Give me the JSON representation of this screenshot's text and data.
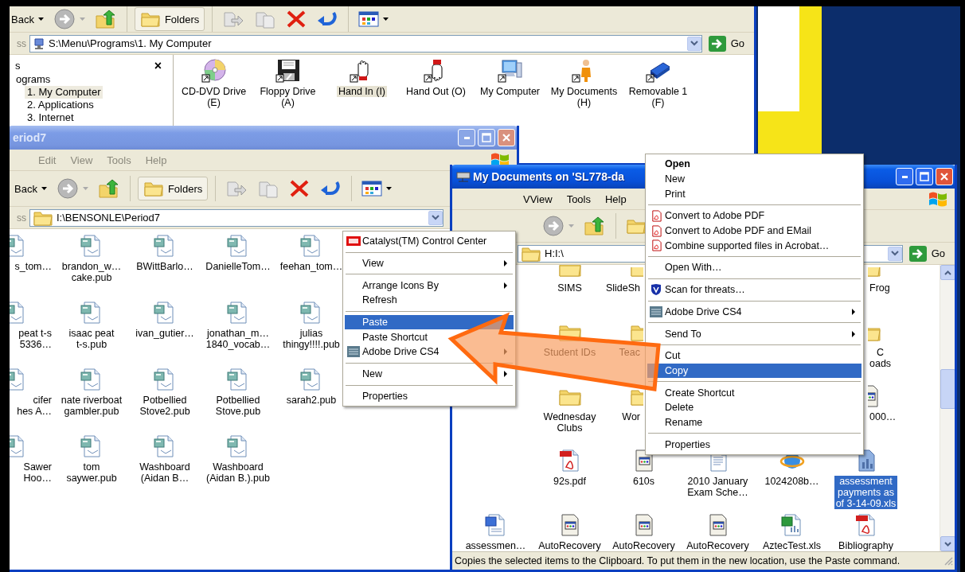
{
  "computer_window": {
    "toolbar": {
      "back": "Back",
      "folders": "Folders"
    },
    "address": {
      "label": "ss",
      "path": "S:\\Menu\\Programs\\1. My Computer",
      "go": "Go"
    },
    "pane": {
      "title": "s",
      "close": "×",
      "tree": [
        {
          "label": "ograms",
          "selected": false,
          "children": [
            {
              "label": "1. My Computer",
              "selected": true
            },
            {
              "label": "2. Applications",
              "selected": false
            },
            {
              "label": "3. Internet",
              "selected": false
            }
          ]
        }
      ]
    },
    "icons": [
      {
        "kind": "cd",
        "label": "CD-DVD Drive\n(E)",
        "selected": false
      },
      {
        "kind": "floppy",
        "label": "Floppy Drive\n(A)",
        "selected": false
      },
      {
        "kind": "hand_in",
        "label": "Hand In (I)",
        "selected": true
      },
      {
        "kind": "hand_out",
        "label": "Hand Out (O)",
        "selected": false
      },
      {
        "kind": "computer",
        "label": "My Computer",
        "selected": false
      },
      {
        "kind": "person",
        "label": "My Documents\n(H)",
        "selected": false
      },
      {
        "kind": "usb",
        "label": "Removable 1\n(F)",
        "selected": false
      }
    ]
  },
  "period_window": {
    "title": "eriod7",
    "active": false,
    "menu": [
      "Edit",
      "View",
      "Tools",
      "Help"
    ],
    "toolbar": {
      "back": "Back",
      "folders": "Folders"
    },
    "address": {
      "label": "ss",
      "path": "I:\\BENSONLE\\Period7"
    },
    "files": [
      [
        {
          "kind": "pub",
          "label": "s_tom…"
        },
        {
          "kind": "pub",
          "label": "brandon_w…\ncake.pub"
        },
        {
          "kind": "pub",
          "label": "BWittBarlo…"
        },
        {
          "kind": "pub",
          "label": "DanielleTom…"
        },
        {
          "kind": "pub",
          "label": "feehan_tom…"
        }
      ],
      [
        {
          "kind": "pub",
          "label": "peat t-s\n5336…"
        },
        {
          "kind": "pub",
          "label": "isaac peat\nt-s.pub"
        },
        {
          "kind": "pub",
          "label": "ivan_gutier…"
        },
        {
          "kind": "pub",
          "label": "jonathan_m…\n1840_vocab…"
        },
        {
          "kind": "pub",
          "label": "julias\nthingy!!!!.pub"
        }
      ],
      [
        {
          "kind": "pub",
          "label": "cifer\nhes A…"
        },
        {
          "kind": "pub",
          "label": "nate riverboat\ngambler.pub"
        },
        {
          "kind": "pub",
          "label": "Potbellied\nStove2.pub"
        },
        {
          "kind": "pub",
          "label": "Potbellied\nStove.pub"
        },
        {
          "kind": "pub",
          "label": "sarah2.pub"
        }
      ],
      [
        {
          "kind": "pub",
          "label": "Sawer\nHoo…"
        },
        {
          "kind": "pub",
          "label": "tom\nsaywer.pub"
        },
        {
          "kind": "pub",
          "label": "Washboard\n(Aidan B…"
        },
        {
          "kind": "pub",
          "label": "Washboard\n(Aidan B.).pub"
        }
      ]
    ]
  },
  "documents_window": {
    "title": "My Documents on 'SL778-da",
    "active": true,
    "menu": [
      "VView",
      "Tools",
      "Help"
    ],
    "address": {
      "path": "H:I:\\",
      "go": "Go"
    },
    "files": [
      {
        "kind": "folder",
        "label": "SIMS",
        "selected": false
      },
      {
        "kind": "folder",
        "label": "SlideSh",
        "selected": false
      },
      {
        "kind": "folder",
        "label": "Frog",
        "selected": false
      },
      {
        "kind": "folder",
        "label": "Student IDs",
        "selected": false
      },
      {
        "kind": "folder",
        "label": "Teac",
        "selected": false
      },
      {
        "kind": "folder",
        "label": "C\noads",
        "selected": false
      },
      {
        "kind": "folder",
        "label": "Wednesday\nClubs",
        "selected": false
      },
      {
        "kind": "folder",
        "label": "Wor",
        "selected": false
      },
      {
        "kind": "app",
        "label": "000…",
        "selected": false
      },
      {
        "kind": "pdf",
        "label": "92s.pdf",
        "selected": false
      },
      {
        "kind": "app",
        "label": "610s",
        "selected": false
      },
      {
        "kind": "text",
        "label": "2010 January\nExam Sche…",
        "selected": false
      },
      {
        "kind": "globe",
        "label": "1024208b…",
        "selected": false
      },
      {
        "kind": "chart",
        "label": "assessment\npayments as\nof 3-14-09.xls",
        "selected": true
      },
      {
        "kind": "word",
        "label": "assessmen…",
        "selected": false
      },
      {
        "kind": "app",
        "label": "AutoRecovery",
        "selected": false
      },
      {
        "kind": "app",
        "label": "AutoRecovery",
        "selected": false
      },
      {
        "kind": "app",
        "label": "AutoRecovery",
        "selected": false
      },
      {
        "kind": "excel",
        "label": "AztecTest.xls",
        "selected": false
      },
      {
        "kind": "pdf",
        "label": "Bibliography",
        "selected": false
      }
    ],
    "status": "Copies the selected items to the Clipboard. To put them in the new location, use the Paste command."
  },
  "folder_menu": [
    {
      "kind": "ati",
      "label": "Catalyst(TM) Control Center",
      "selected": false,
      "submenu": false
    },
    {
      "kind": "separator"
    },
    {
      "kind": "text",
      "label": "View",
      "selected": false,
      "submenu": true
    },
    {
      "kind": "separator"
    },
    {
      "kind": "text",
      "label": "Arrange Icons By",
      "selected": false,
      "submenu": true
    },
    {
      "kind": "text",
      "label": "Refresh",
      "selected": false,
      "submenu": false
    },
    {
      "kind": "separator"
    },
    {
      "kind": "text",
      "label": "Paste",
      "selected": true,
      "submenu": false
    },
    {
      "kind": "text",
      "label": "Paste Shortcut",
      "selected": false,
      "submenu": false
    },
    {
      "kind": "drive",
      "label": "Adobe Drive CS4",
      "selected": false,
      "submenu": true
    },
    {
      "kind": "separator"
    },
    {
      "kind": "text",
      "label": "New",
      "selected": false,
      "submenu": true
    },
    {
      "kind": "separator"
    },
    {
      "kind": "text",
      "label": "Properties",
      "selected": false,
      "submenu": false
    }
  ],
  "file_menu": [
    {
      "kind": "text",
      "label": "Open",
      "default": true,
      "selected": false,
      "submenu": false
    },
    {
      "kind": "text",
      "label": "New",
      "default": false,
      "selected": false,
      "submenu": false
    },
    {
      "kind": "text",
      "label": "Print",
      "default": false,
      "selected": false,
      "submenu": false
    },
    {
      "kind": "separator"
    },
    {
      "kind": "pdf",
      "label": "Convert to Adobe PDF",
      "default": false,
      "selected": false,
      "submenu": false
    },
    {
      "kind": "pdf",
      "label": "Convert to Adobe PDF and EMail",
      "default": false,
      "selected": false,
      "submenu": false
    },
    {
      "kind": "pdf",
      "label": "Combine supported files in Acrobat…",
      "default": false,
      "selected": false,
      "submenu": false
    },
    {
      "kind": "separator"
    },
    {
      "kind": "text",
      "label": "Open With…",
      "default": false,
      "selected": false,
      "submenu": false
    },
    {
      "kind": "separator"
    },
    {
      "kind": "shield",
      "label": "Scan for threats…",
      "default": false,
      "selected": false,
      "submenu": false
    },
    {
      "kind": "separator"
    },
    {
      "kind": "drive",
      "label": "Adobe Drive CS4",
      "default": false,
      "selected": false,
      "submenu": true
    },
    {
      "kind": "separator"
    },
    {
      "kind": "text",
      "label": "Send To",
      "default": false,
      "selected": false,
      "submenu": true
    },
    {
      "kind": "separator"
    },
    {
      "kind": "text",
      "label": "Cut",
      "default": false,
      "selected": false,
      "submenu": false
    },
    {
      "kind": "text",
      "label": "Copy",
      "default": false,
      "selected": true,
      "submenu": false
    },
    {
      "kind": "separator"
    },
    {
      "kind": "text",
      "label": "Create Shortcut",
      "default": false,
      "selected": false,
      "submenu": false
    },
    {
      "kind": "text",
      "label": "Delete",
      "default": false,
      "selected": false,
      "submenu": false
    },
    {
      "kind": "text",
      "label": "Rename",
      "default": false,
      "selected": false,
      "submenu": false
    },
    {
      "kind": "separator"
    },
    {
      "kind": "text",
      "label": "Properties",
      "default": false,
      "selected": false,
      "submenu": false
    }
  ]
}
